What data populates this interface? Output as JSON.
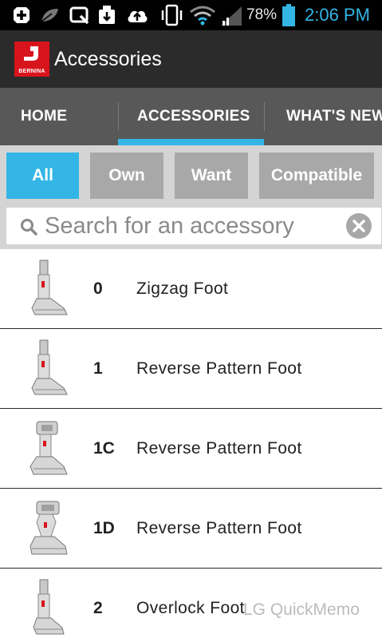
{
  "status_bar": {
    "battery_percent": "78%",
    "time": "2:06 PM",
    "icons": [
      "add-icon",
      "leaf-icon",
      "screenshot-icon",
      "download-icon",
      "cloud-upload-icon",
      "vibrate-icon",
      "wifi-icon",
      "signal-icon",
      "battery-icon"
    ]
  },
  "app_bar": {
    "logo_text": "BERNINA",
    "title": "Accessories"
  },
  "tabs": [
    {
      "label": "HOME",
      "active": false
    },
    {
      "label": "ACCESSORIES",
      "active": true
    },
    {
      "label": "WHAT'S NEW",
      "active": false
    }
  ],
  "colors": {
    "accent": "#33b5e5",
    "brand_red": "#d8141c",
    "inactive_filter": "#a8a8a8"
  },
  "filters": [
    {
      "label": "All",
      "active": true
    },
    {
      "label": "Own",
      "active": false
    },
    {
      "label": "Want",
      "active": false
    },
    {
      "label": "Compatible",
      "active": false
    }
  ],
  "search": {
    "placeholder": "Search for an accessory",
    "value": ""
  },
  "accessories": [
    {
      "number": "0",
      "name": "Zigzag Foot",
      "icon": "presser-foot-image"
    },
    {
      "number": "1",
      "name": "Reverse Pattern Foot",
      "icon": "presser-foot-image"
    },
    {
      "number": "1C",
      "name": "Reverse Pattern Foot",
      "icon": "presser-foot-clip-image"
    },
    {
      "number": "1D",
      "name": "Reverse Pattern Foot",
      "icon": "presser-foot-clip-image"
    },
    {
      "number": "2",
      "name": "Overlock Foot",
      "icon": "presser-foot-image"
    }
  ],
  "watermark": "LG QuickMemo"
}
